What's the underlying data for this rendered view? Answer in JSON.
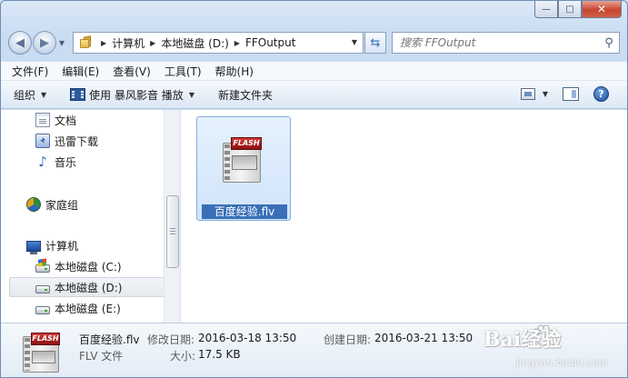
{
  "window": {
    "caption_buttons": {
      "minimize": "—",
      "maximize": "□",
      "close": "✕"
    }
  },
  "address_bar": {
    "crumbs": [
      "计算机",
      "本地磁盘 (D:)",
      "FFOutput"
    ],
    "search_placeholder": "搜索 FFOutput"
  },
  "menu": [
    "文件(F)",
    "编辑(E)",
    "查看(V)",
    "工具(T)",
    "帮助(H)"
  ],
  "commandbar": {
    "organize": "组织",
    "open_with": "使用 暴风影音 播放",
    "new_folder": "新建文件夹"
  },
  "navpane": {
    "items": [
      {
        "label": "文档",
        "icon": "document-icon"
      },
      {
        "label": "迅雷下载",
        "icon": "thunder-icon"
      },
      {
        "label": "音乐",
        "icon": "music-icon"
      },
      {
        "label": "家庭组",
        "icon": "homegroup-icon"
      },
      {
        "label": "计算机",
        "icon": "computer-icon"
      },
      {
        "label": "本地磁盘 (C:)",
        "icon": "windows-drive-icon"
      },
      {
        "label": "本地磁盘 (D:)",
        "icon": "drive-icon",
        "selected": true
      },
      {
        "label": "本地磁盘 (E:)",
        "icon": "drive-icon"
      }
    ]
  },
  "files": [
    {
      "name": "百度经验.flv",
      "icon": "flash-video-icon",
      "badge": "FLASH",
      "selected": true
    }
  ],
  "details": {
    "name": "百度经验.flv",
    "type": "FLV 文件",
    "modified_label": "修改日期:",
    "modified": "2016-03-18 13:50",
    "size_label": "大小:",
    "size": "17.5 KB",
    "created_label": "创建日期:",
    "created": "2016-03-21 13:50"
  },
  "watermark": {
    "logo": "Bai经验",
    "url": "jingyan.baidu.com"
  },
  "colors": {
    "selection": "#3a6fb7",
    "tile_bg": "#cfe4fb",
    "chrome": "#c9dcf2"
  }
}
